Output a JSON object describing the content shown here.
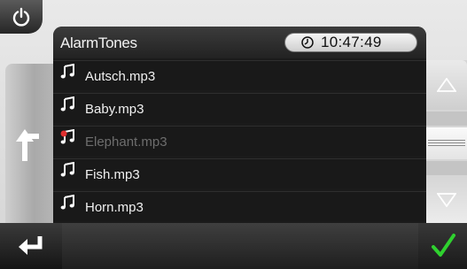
{
  "header": {
    "title": "AlarmTones",
    "time": "10:47:49"
  },
  "files": [
    {
      "name": "Autsch.mp3",
      "icon": "music-note-icon",
      "state": "normal"
    },
    {
      "name": "Baby.mp3",
      "icon": "music-note-icon",
      "state": "normal"
    },
    {
      "name": "Elephant.mp3",
      "icon": "music-note-marked-icon",
      "state": "disabled"
    },
    {
      "name": "Fish.mp3",
      "icon": "music-note-icon",
      "state": "normal"
    },
    {
      "name": "Horn.mp3",
      "icon": "music-note-icon",
      "state": "normal"
    }
  ],
  "icons": {
    "power": "power-icon",
    "back": "back-arrow-icon",
    "scroll_up": "triangle-up-icon",
    "scroll_down": "triangle-down-icon",
    "enter": "enter-arrow-icon",
    "ok": "checkmark-icon",
    "clock": "clock-icon"
  },
  "colors": {
    "accent_green": "#2fd12f",
    "marker_red": "#e03030"
  }
}
